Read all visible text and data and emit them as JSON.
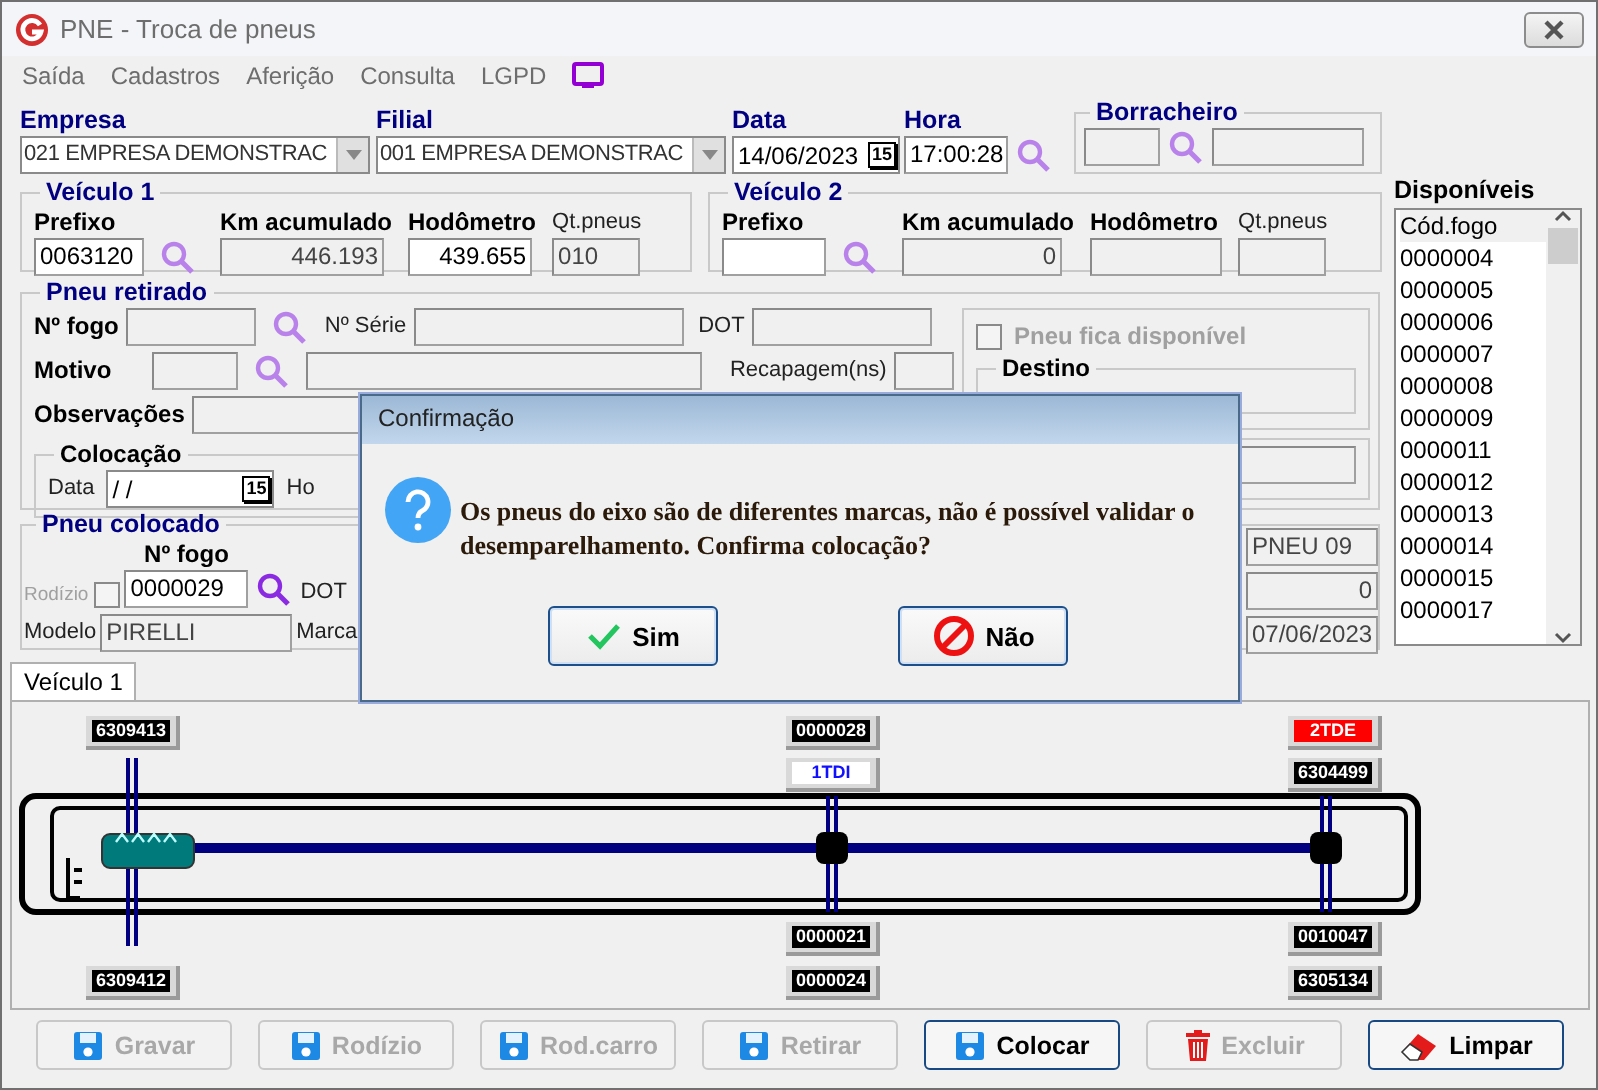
{
  "window": {
    "title": "PNE - Troca de pneus"
  },
  "menu": [
    "Saída",
    "Cadastros",
    "Aferição",
    "Consulta",
    "LGPD"
  ],
  "header": {
    "empresa": {
      "label": "Empresa",
      "value": "021 EMPRESA DEMONSTRAC"
    },
    "filial": {
      "label": "Filial",
      "value": "001 EMPRESA DEMONSTRAC"
    },
    "data": {
      "label": "Data",
      "value": "14/06/2023",
      "calendar_day": "15"
    },
    "hora": {
      "label": "Hora",
      "value": "17:00:28"
    },
    "borracheiro": {
      "title": "Borracheiro"
    }
  },
  "veiculo1": {
    "title": "Veículo 1",
    "prefixo": {
      "label": "Prefixo",
      "value": "0063120"
    },
    "km": {
      "label": "Km acumulado",
      "value": "446.193"
    },
    "hodometro": {
      "label": "Hodômetro",
      "value": "439.655"
    },
    "qt_pneus": {
      "label": "Qt.pneus",
      "value": "010"
    }
  },
  "veiculo2": {
    "title": "Veículo 2",
    "prefixo": {
      "label": "Prefixo"
    },
    "km": {
      "label": "Km acumulado",
      "value": "0"
    },
    "hodometro": {
      "label": "Hodômetro"
    },
    "qt_pneus": {
      "label": "Qt.pneus"
    }
  },
  "disponiveis": {
    "title": "Disponíveis",
    "header": "Cód.fogo",
    "items": [
      "0000004",
      "0000005",
      "0000006",
      "0000007",
      "0000008",
      "0000009",
      "0000011",
      "0000012",
      "0000013",
      "0000014",
      "0000015",
      "0000017"
    ]
  },
  "pneu_retirado": {
    "title": "Pneu retirado",
    "n_fogo_label": "Nº fogo",
    "n_serie_label": "Nº Série",
    "dot_label": "DOT",
    "motivo_label": "Motivo",
    "recapagem_label": "Recapagem(ns)",
    "observacoes_label": "Observações",
    "colocacao": {
      "title": "Colocação",
      "data_label": "Data",
      "data_value": "/  /",
      "calendar_day": "15",
      "hora_label": "Ho"
    },
    "fica_disponivel": {
      "label": "Pneu fica disponível",
      "checked": false,
      "disabled": true
    },
    "destino": {
      "title": "Destino"
    }
  },
  "pneu_colocado": {
    "title": "Pneu colocado",
    "rodizio": {
      "label": "Rodízio",
      "checked": false,
      "disabled": true
    },
    "n_fogo": {
      "label": "Nº fogo",
      "value": "0000029"
    },
    "dot_label": "DOT",
    "modelo": {
      "label": "Modelo",
      "value": "PIRELLI"
    },
    "marca_label": "Marca",
    "side_values": [
      "PNEU 09",
      "0",
      "07/06/2023"
    ]
  },
  "tabs": [
    {
      "label": "Veículo 1",
      "selected": true
    }
  ],
  "diagram": {
    "tire_labels": [
      {
        "text": "6309413",
        "kind": "plain"
      },
      {
        "text": "0000028",
        "kind": "plain"
      },
      {
        "text": "2TDE",
        "kind": "alert"
      },
      {
        "text": "1TDI",
        "kind": "marked"
      },
      {
        "text": "6304499",
        "kind": "plain"
      },
      {
        "text": "0000021",
        "kind": "plain"
      },
      {
        "text": "0010047",
        "kind": "plain"
      },
      {
        "text": "6309412",
        "kind": "plain"
      },
      {
        "text": "0000024",
        "kind": "plain"
      },
      {
        "text": "6305134",
        "kind": "plain"
      }
    ]
  },
  "buttons": [
    {
      "label": "Gravar",
      "kind": "save",
      "disabled": true
    },
    {
      "label": "Rodízio",
      "kind": "save",
      "disabled": true
    },
    {
      "label": "Rod.carro",
      "kind": "save",
      "disabled": true
    },
    {
      "label": "Retirar",
      "kind": "save",
      "disabled": true
    },
    {
      "label": "Colocar",
      "kind": "save",
      "disabled": false
    },
    {
      "label": "Excluir",
      "kind": "delete",
      "disabled": true
    },
    {
      "label": "Limpar",
      "kind": "clear",
      "disabled": false
    }
  ],
  "dialog": {
    "title": "Confirmação",
    "message": "Os pneus do eixo são de diferentes marcas, não é possível validar o desemparelhamento. Confirma colocação?",
    "buttons": [
      {
        "label": "Sim",
        "kind": "confirm"
      },
      {
        "label": "Não",
        "kind": "cancel"
      }
    ]
  }
}
